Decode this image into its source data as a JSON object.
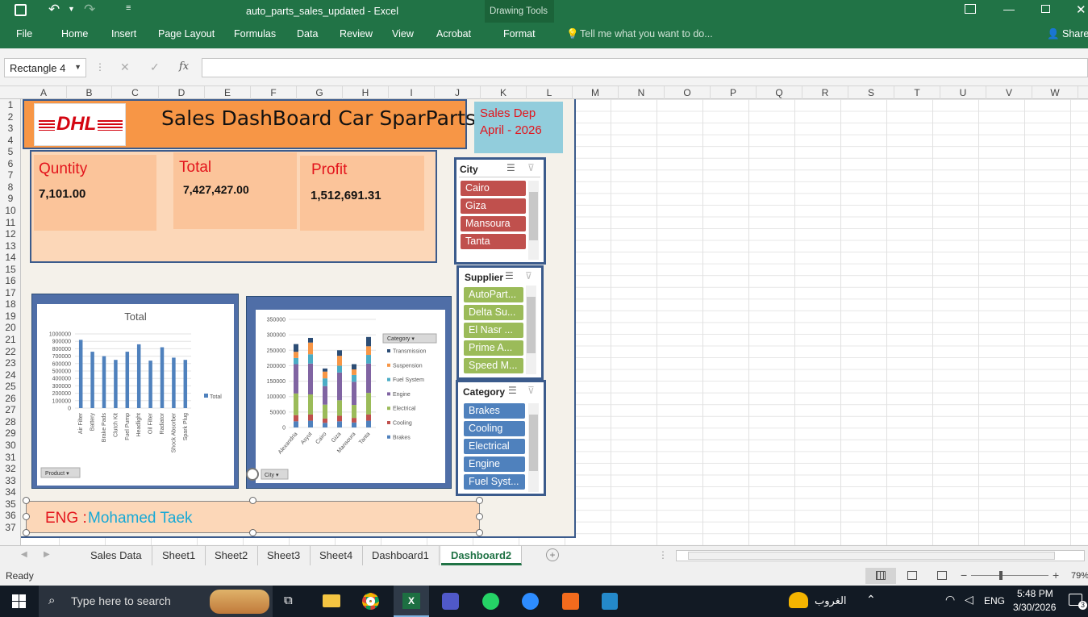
{
  "titlebar": {
    "filename": "auto_parts_sales_updated - Excel",
    "drawing_tools": "Drawing Tools"
  },
  "ribbon": {
    "tabs": [
      "File",
      "Home",
      "Insert",
      "Page Layout",
      "Formulas",
      "Data",
      "Review",
      "View",
      "Acrobat",
      "Format"
    ],
    "tell_me": "Tell me what you want to do...",
    "share": "Share"
  },
  "formula": {
    "name_box": "Rectangle 4",
    "fx": "fx"
  },
  "columns": [
    "A",
    "B",
    "C",
    "D",
    "E",
    "F",
    "G",
    "H",
    "I",
    "J",
    "K",
    "L",
    "M",
    "N",
    "O",
    "P",
    "Q",
    "R",
    "S",
    "T",
    "U",
    "V",
    "W"
  ],
  "rows": [
    "1",
    "2",
    "3",
    "4",
    "5",
    "6",
    "7",
    "8",
    "9",
    "10",
    "11",
    "12",
    "13",
    "14",
    "15",
    "16",
    "17",
    "18",
    "19",
    "20",
    "21",
    "22",
    "23",
    "24",
    "25",
    "26",
    "27",
    "28",
    "29",
    "30",
    "31",
    "32",
    "33",
    "34",
    "35",
    "36",
    "37"
  ],
  "dashboard": {
    "title": "Sales DashBoard Car SparParts",
    "logo": "DHL",
    "dept_line1": "Sales Dep",
    "dept_line2": "April - 2026",
    "kpis": [
      {
        "label": "Quntity",
        "value": "7,101.00"
      },
      {
        "label": "Total",
        "value": "7,427,427.00"
      },
      {
        "label": "Profit",
        "value": "1,512,691.31"
      }
    ],
    "footer_prefix": "ENG : ",
    "footer_name": "Mohamed Taek"
  },
  "slicers": {
    "city": {
      "title": "City",
      "items": [
        "Cairo",
        "Giza",
        "Mansoura",
        "Tanta"
      ]
    },
    "supplier": {
      "title": "Supplier",
      "items": [
        "AutoPart...",
        "Delta Su...",
        "El Nasr ...",
        "Prime A...",
        "Speed M..."
      ]
    },
    "category": {
      "title": "Category",
      "items": [
        "Brakes",
        "Cooling",
        "Electrical",
        "Engine",
        "Fuel Syst..."
      ]
    }
  },
  "chart_data": [
    {
      "type": "bar",
      "title": "Total",
      "categories": [
        "Air Filter",
        "Battery",
        "Brake Pads",
        "Clutch Kit",
        "Fuel Pump",
        "Headlight",
        "Oil Filter",
        "Radiator",
        "Shock Absorber",
        "Spark Plug"
      ],
      "series": [
        {
          "name": "Total",
          "values": [
            920000,
            760000,
            700000,
            650000,
            760000,
            860000,
            640000,
            820000,
            680000,
            650000
          ]
        }
      ],
      "yticks": [
        "1000000",
        "900000",
        "800000",
        "700000",
        "600000",
        "500000",
        "400000",
        "300000",
        "200000",
        "100000",
        "0"
      ],
      "ylim": [
        0,
        1000000
      ],
      "filter_button": "Product",
      "color": "#4f81bd"
    },
    {
      "type": "bar",
      "stacked": true,
      "categories": [
        "Alexandria",
        "Asyut",
        "Cairo",
        "Giza",
        "Mansoura",
        "Tanta"
      ],
      "series": [
        {
          "name": "Brakes",
          "values": [
            20000,
            22000,
            15000,
            20000,
            16000,
            22000
          ],
          "color": "#4f81bd"
        },
        {
          "name": "Cooling",
          "values": [
            20000,
            20000,
            14000,
            18000,
            15000,
            20000
          ],
          "color": "#c0504d"
        },
        {
          "name": "Electrical",
          "values": [
            70000,
            65000,
            45000,
            50000,
            42000,
            70000
          ],
          "color": "#9bbb59"
        },
        {
          "name": "Engine",
          "values": [
            95000,
            100000,
            60000,
            90000,
            75000,
            95000
          ],
          "color": "#8064a2"
        },
        {
          "name": "Fuel System",
          "values": [
            20000,
            30000,
            25000,
            22000,
            22000,
            28000
          ],
          "color": "#4bacc6"
        },
        {
          "name": "Suspension",
          "values": [
            20000,
            38000,
            22000,
            32000,
            18000,
            28000
          ],
          "color": "#f79646"
        },
        {
          "name": "Transmission",
          "values": [
            25000,
            15000,
            10000,
            18000,
            17000,
            30000
          ],
          "color": "#2c4d75"
        }
      ],
      "yticks": [
        "350000",
        "300000",
        "250000",
        "200000",
        "150000",
        "100000",
        "50000",
        "0"
      ],
      "ylim": [
        0,
        350000
      ],
      "legend_title": "Category",
      "filter_button": "City"
    }
  ],
  "sheets": [
    "Sales Data",
    "Sheet1",
    "Sheet2",
    "Sheet3",
    "Sheet4",
    "Dashboard1",
    "Dashboard2"
  ],
  "active_sheet": "Dashboard2",
  "status": {
    "ready": "Ready",
    "zoom": "79%"
  },
  "taskbar": {
    "search": "Type here to search",
    "lang": "ENG",
    "weather": "الغروب",
    "time": "5:48 PM",
    "date": "3/30/2026",
    "notif": "3"
  }
}
